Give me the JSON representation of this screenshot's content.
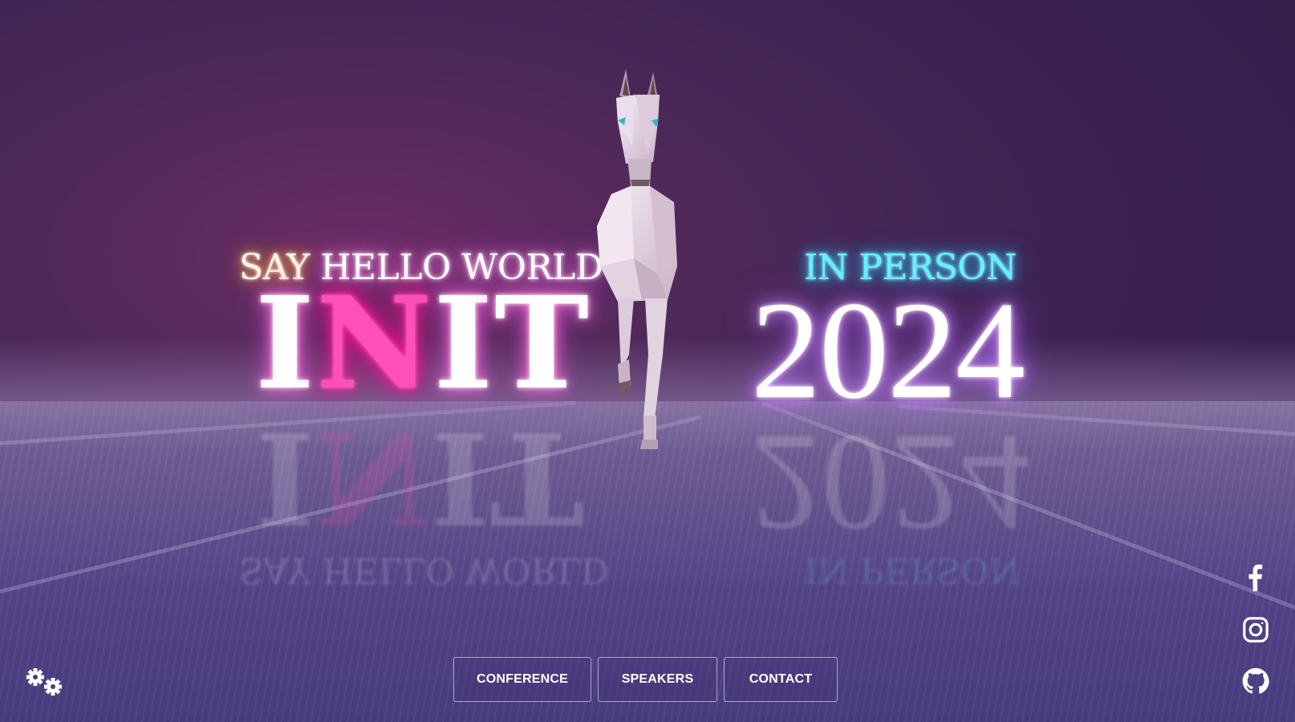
{
  "hero": {
    "say_word": "SAY",
    "hello_world": "HELLO WORLD",
    "init_letters": [
      "I",
      "N",
      "I",
      "T"
    ],
    "in_person": "IN PERSON",
    "year": "2024"
  },
  "nav": {
    "buttons": [
      "CONFERENCE",
      "SPEAKERS",
      "CONTACT"
    ]
  },
  "social": {
    "icons": [
      "facebook-icon",
      "instagram-icon",
      "github-icon"
    ]
  },
  "settings": {
    "icon": "gears-icon"
  },
  "colors": {
    "background": "#3a2150",
    "floor": "#6b5a93",
    "neon_pink": "#ff4fb8",
    "neon_cyan": "#62f3ff",
    "neon_warm": "#ffb650"
  }
}
